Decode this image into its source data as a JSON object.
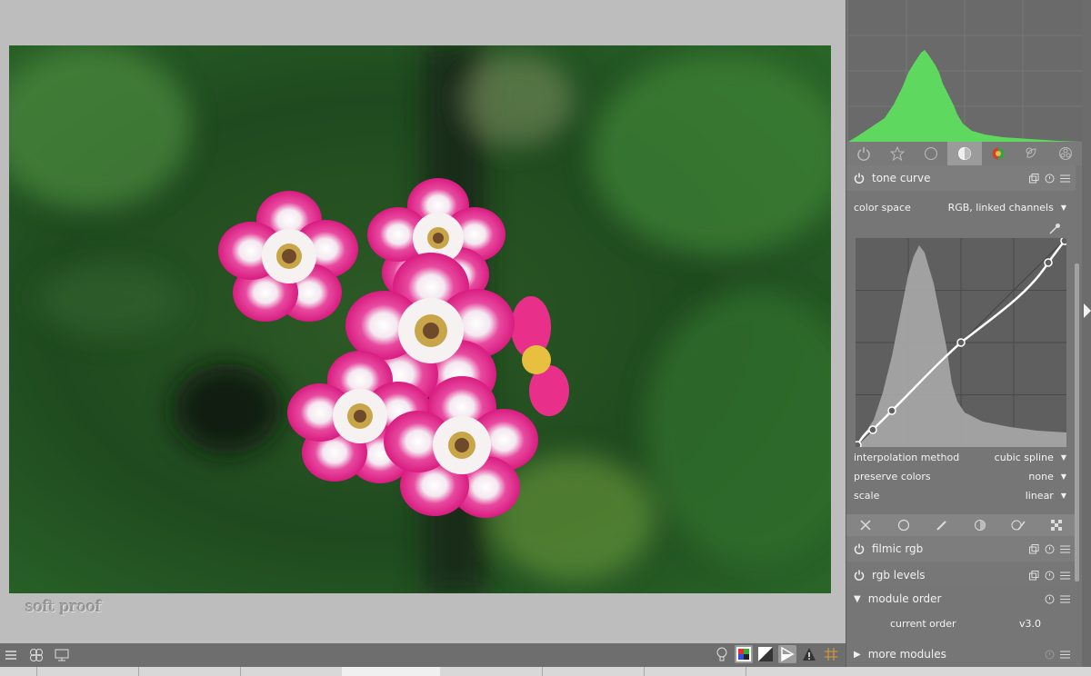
{
  "overlay": {
    "soft_proof_label": "soft proof"
  },
  "tone_curve": {
    "title": "tone curve",
    "color_space_label": "color space",
    "color_space_value": "RGB, linked channels",
    "interpolation_label": "interpolation method",
    "interpolation_value": "cubic spline",
    "preserve_label": "preserve colors",
    "preserve_value": "none",
    "scale_label": "scale",
    "scale_value": "linear"
  },
  "modules": {
    "filmic": "filmic rgb",
    "levels": "rgb levels",
    "module_order": "module order",
    "current_order_label": "current order",
    "current_order_value": "v3.0",
    "more_modules": "more modules"
  },
  "icons": {
    "tabs": [
      "power-icon",
      "star-icon",
      "circle-icon",
      "half-circle-icon",
      "color-ball-icon",
      "correct-icon",
      "effect-icon"
    ],
    "bottom_tools": [
      "close-icon",
      "circle-mask-icon",
      "pen-icon",
      "gradient-icon",
      "brush-icon",
      "parametric-icon"
    ]
  },
  "colors": {
    "histogram": "#5fd85f",
    "panel": "#767676",
    "accent": "#ffffff"
  }
}
